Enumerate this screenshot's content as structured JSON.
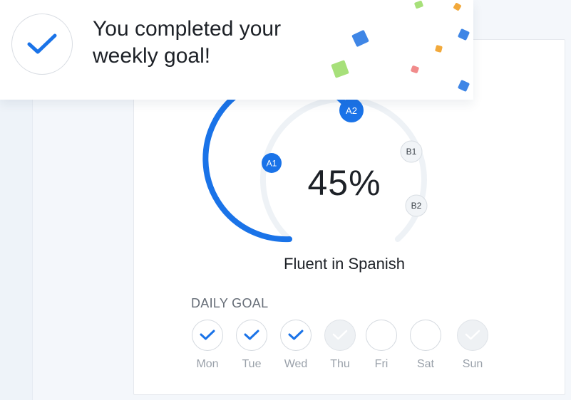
{
  "toast": {
    "message_line1": "You completed your",
    "message_line2": "weekly goal!"
  },
  "progress": {
    "percent_label": "45%",
    "percent": 45,
    "language_caption": "Fluent in Spanish",
    "levels": [
      {
        "label": "A1",
        "reached": true
      },
      {
        "label": "A2",
        "reached": true
      },
      {
        "label": "B1",
        "reached": false
      },
      {
        "label": "B2",
        "reached": false
      }
    ]
  },
  "daily_goal": {
    "title": "DAILY GOAL",
    "days": [
      {
        "label": "Mon",
        "state": "completed"
      },
      {
        "label": "Tue",
        "state": "completed"
      },
      {
        "label": "Wed",
        "state": "completed"
      },
      {
        "label": "Thu",
        "state": "upcoming-checked"
      },
      {
        "label": "Fri",
        "state": "empty"
      },
      {
        "label": "Sat",
        "state": "empty"
      },
      {
        "label": "Sun",
        "state": "upcoming-checked"
      }
    ]
  },
  "colors": {
    "accent_blue": "#1a73e8",
    "track_gray": "#eef2f6",
    "confetti_green": "#a7e07a",
    "confetti_orange": "#f2a93b",
    "confetti_red": "#f18b8b",
    "text_dark": "#1d2127"
  },
  "icons": {
    "toast": "check-icon",
    "day_completed": "check-icon",
    "day_future": "check-icon"
  }
}
